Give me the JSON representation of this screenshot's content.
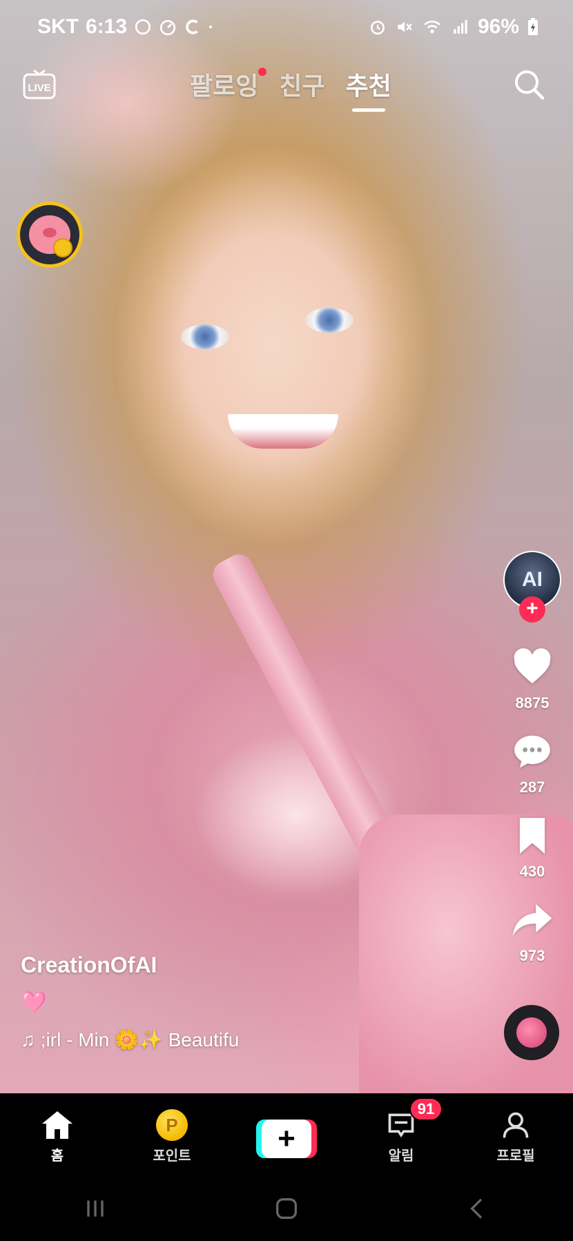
{
  "status_bar": {
    "carrier": "SKT",
    "time": "6:13",
    "battery": "96%"
  },
  "top_nav": {
    "tabs": [
      {
        "label": "팔로잉",
        "has_dot": true,
        "active": false
      },
      {
        "label": "친구",
        "has_dot": false,
        "active": false
      },
      {
        "label": "추천",
        "has_dot": false,
        "active": true
      }
    ],
    "live_label": "LIVE"
  },
  "creator": {
    "avatar_text": "AI"
  },
  "actions": {
    "likes": "8875",
    "comments": "287",
    "saves": "430",
    "shares": "973"
  },
  "caption": {
    "username": "CreationOfAI",
    "description": "🩷",
    "music": "♫ ;irl - Min 🌼✨    Beautifu"
  },
  "bottom_nav": {
    "items": [
      {
        "label": "홈",
        "icon": "home-icon"
      },
      {
        "label": "포인트",
        "icon": "points-coin-icon"
      },
      {
        "label": "",
        "icon": "create-icon"
      },
      {
        "label": "알림",
        "icon": "inbox-icon",
        "badge": "91"
      },
      {
        "label": "프로필",
        "icon": "profile-icon"
      }
    ]
  },
  "colors": {
    "accent": "#fe2c55",
    "cyan": "#25f4ee",
    "coin": "#f5b800"
  }
}
